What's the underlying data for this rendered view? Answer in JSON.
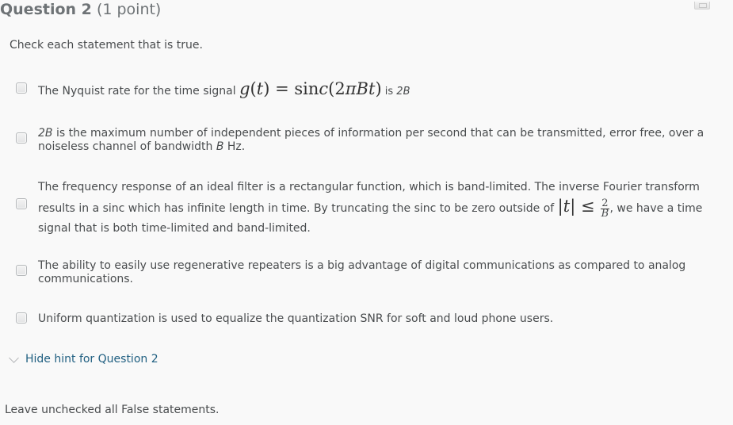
{
  "question": {
    "title": "Question 2",
    "points": "(1 point)",
    "instruction": "Check each statement that is true.",
    "corner_icon": "window-restore-icon"
  },
  "options": [
    {
      "checked": false,
      "text_before": "The Nyquist rate for the time signal ",
      "math_g": "g",
      "math_t_open": "(",
      "math_t": "t",
      "math_t_close": ")",
      "math_eq": " = ",
      "math_sin": "sin",
      "math_c": "c",
      "math_arg_open": "(",
      "math_arg_2": "2",
      "math_arg_pi": "π",
      "math_arg_B": "B",
      "math_arg_t": "t",
      "math_arg_close": ")",
      "text_after": " is ",
      "text_italic": "2B"
    },
    {
      "checked": false,
      "italic_lead": "2B",
      "text_1": " is the maximum number of independent pieces of information per second that can be transmitted, error free, over a noiseless channel of bandwidth ",
      "italic_B": "B",
      "text_2": " Hz."
    },
    {
      "checked": false,
      "text_1": "The frequency response of an ideal filter is a rectangular function, which is band-limited. The inverse Fourier transform results in a sinc which has infinite length in time. By truncating the sinc to be zero outside of ",
      "abs_bar": "|",
      "abs_t": "t",
      "le": " ≤ ",
      "frac_num": "2",
      "frac_den": "B",
      "text_2": ", we have a time signal that is both time-limited and band-limited."
    },
    {
      "checked": false,
      "text": "The ability to easily use regenerative repeaters is a big advantage of digital communications as compared to analog communications."
    },
    {
      "checked": false,
      "text": "Uniform quantization is used to equalize the quantization SNR for soft and loud phone users."
    }
  ],
  "hint": {
    "toggle_label": "Hide hint for Question 2",
    "toggle_icon": "chevron-down-icon",
    "text": "Leave unchecked all False statements."
  }
}
